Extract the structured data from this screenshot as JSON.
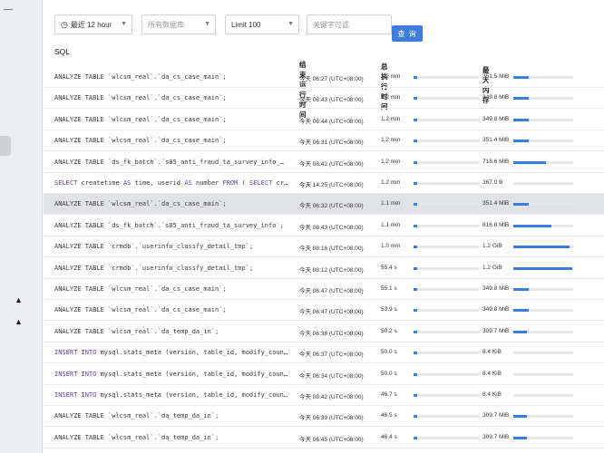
{
  "toolbar": {
    "time_range": "最近 12 hour",
    "database": "所有数据库",
    "limit": "Limit 100",
    "keyword_placeholder": "关键字过滤",
    "search_button": "查 询"
  },
  "columns": {
    "sql": "SQL",
    "end_time": "结束运行时间",
    "total_exec_time": "总执行时间",
    "max_memory": "最大内存"
  },
  "rows": [
    {
      "sql_parts": [
        {
          "t": "ANALYZE TABLE `wlcsm_real`.`da_cs_case_main`;",
          "kw": false
        }
      ],
      "end_time": "今天 06:27 (UTC+08:00)",
      "duration": "1.2 min",
      "duration_fraction": 0.06,
      "memory": "351.5 MiB",
      "memory_fraction": 0.26,
      "highlight": false
    },
    {
      "sql_parts": [
        {
          "t": "ANALYZE TABLE `wlcsm_real`.`da_cs_case_main`;",
          "kw": false
        }
      ],
      "end_time": "今天 06:43 (UTC+08:00)",
      "duration": "1.2 min",
      "duration_fraction": 0.06,
      "memory": "349.8 MiB",
      "memory_fraction": 0.26,
      "highlight": false
    },
    {
      "sql_parts": [
        {
          "t": "ANALYZE TABLE `wlcsm_real`.`da_cs_case_main`;",
          "kw": false
        }
      ],
      "end_time": "今天 06:44 (UTC+08:00)",
      "duration": "1.2 min",
      "duration_fraction": 0.06,
      "memory": "349.8 MiB",
      "memory_fraction": 0.26,
      "highlight": false
    },
    {
      "sql_parts": [
        {
          "t": "ANALYZE TABLE `wlcsm_real`.`da_cs_case_main`;",
          "kw": false
        }
      ],
      "end_time": "今天 06:31 (UTC+08:00)",
      "duration": "1.2 min",
      "duration_fraction": 0.06,
      "memory": "351.4 MiB",
      "memory_fraction": 0.26,
      "highlight": false
    },
    {
      "sql_parts": [
        {
          "t": "ANALYZE TABLE `ds_fk_batch`.`s05_anti_fraud_ta_survey_info_…",
          "kw": false
        }
      ],
      "end_time": "今天 08:42 (UTC+08:00)",
      "duration": "1.2 min",
      "duration_fraction": 0.06,
      "memory": "718.6 MiB",
      "memory_fraction": 0.55,
      "highlight": false
    },
    {
      "sql_parts": [
        {
          "t": "SELECT",
          "kw": true
        },
        {
          "t": " createtime ",
          "kw": false
        },
        {
          "t": "AS",
          "kw": true
        },
        {
          "t": " time, userid ",
          "kw": false
        },
        {
          "t": "AS",
          "kw": true
        },
        {
          "t": " number ",
          "kw": false
        },
        {
          "t": "FROM",
          "kw": true
        },
        {
          "t": " ( ",
          "kw": false
        },
        {
          "t": "SELECT",
          "kw": true
        },
        {
          "t": " cr…",
          "kw": false
        }
      ],
      "end_time": "今天 14:25 (UTC+08:00)",
      "duration": "1.2 min",
      "duration_fraction": 0.06,
      "memory": "367.0 B",
      "memory_fraction": 0.0,
      "highlight": false
    },
    {
      "sql_parts": [
        {
          "t": "ANALYZE TABLE `wlcsm_real`.`da_cs_case_main`;",
          "kw": false
        }
      ],
      "end_time": "今天 06:32 (UTC+08:00)",
      "duration": "1.1 min",
      "duration_fraction": 0.06,
      "memory": "351.4 MiB",
      "memory_fraction": 0.26,
      "highlight": true
    },
    {
      "sql_parts": [
        {
          "t": "ANALYZE TABLE `ds_fk_batch`.`s05_anti_fraud_ta_survey_info`;",
          "kw": false
        }
      ],
      "end_time": "今天 08:43 (UTC+08:00)",
      "duration": "1.1 min",
      "duration_fraction": 0.06,
      "memory": "816.8 MiB",
      "memory_fraction": 0.63,
      "highlight": false
    },
    {
      "sql_parts": [
        {
          "t": "ANALYZE TABLE `crmdb`.`userinfo_classfy_detail_tmp`;",
          "kw": false
        }
      ],
      "end_time": "今天 08:16 (UTC+08:00)",
      "duration": "1.0 min",
      "duration_fraction": 0.05,
      "memory": "1.2 GiB",
      "memory_fraction": 0.94,
      "highlight": false
    },
    {
      "sql_parts": [
        {
          "t": "ANALYZE TABLE `crmdb`.`userinfo_classfy_detail_tmp`;",
          "kw": false
        }
      ],
      "end_time": "今天 08:12 (UTC+08:00)",
      "duration": "55.4 s",
      "duration_fraction": 0.05,
      "memory": "1.2 GiB",
      "memory_fraction": 0.98,
      "highlight": false
    },
    {
      "sql_parts": [
        {
          "t": "ANALYZE TABLE `wlcsm_real`.`da_cs_case_main`;",
          "kw": false
        }
      ],
      "end_time": "今天 06:47 (UTC+08:00)",
      "duration": "55.1 s",
      "duration_fraction": 0.05,
      "memory": "349.8 MiB",
      "memory_fraction": 0.26,
      "highlight": false
    },
    {
      "sql_parts": [
        {
          "t": "ANALYZE TABLE `wlcsm_real`.`da_cs_case_main`;",
          "kw": false
        }
      ],
      "end_time": "今天 06:47 (UTC+08:00)",
      "duration": "53.9 s",
      "duration_fraction": 0.05,
      "memory": "349.8 MiB",
      "memory_fraction": 0.26,
      "highlight": false
    },
    {
      "sql_parts": [
        {
          "t": "ANALYZE TABLE `wlcsm_real`.`da_temp_da_in`;",
          "kw": false
        }
      ],
      "end_time": "今天 06:38 (UTC+08:00)",
      "duration": "50.2 s",
      "duration_fraction": 0.05,
      "memory": "309.7 MiB",
      "memory_fraction": 0.23,
      "highlight": false
    },
    {
      "sql_parts": [
        {
          "t": "INSERT INTO",
          "kw": true
        },
        {
          "t": " mysql.stats_meta (version, table_id, modify_coun…",
          "kw": false
        }
      ],
      "end_time": "今天 06:37 (UTC+08:00)",
      "duration": "50.0 s",
      "duration_fraction": 0.05,
      "memory": "8.4 KiB",
      "memory_fraction": 0.0,
      "highlight": false
    },
    {
      "sql_parts": [
        {
          "t": "INSERT INTO",
          "kw": true
        },
        {
          "t": " mysql.stats_meta (version, table_id, modify_coun…",
          "kw": false
        }
      ],
      "end_time": "今天 06:34 (UTC+08:00)",
      "duration": "50.0 s",
      "duration_fraction": 0.05,
      "memory": "8.4 KiB",
      "memory_fraction": 0.0,
      "highlight": false
    },
    {
      "sql_parts": [
        {
          "t": "INSERT INTO",
          "kw": true
        },
        {
          "t": " mysql.stats_meta (version, table_id, modify_coun…",
          "kw": false
        }
      ],
      "end_time": "今天 08:42 (UTC+08:00)",
      "duration": "46.7 s",
      "duration_fraction": 0.05,
      "memory": "8.4 KiB",
      "memory_fraction": 0.0,
      "highlight": false
    },
    {
      "sql_parts": [
        {
          "t": "ANALYZE TABLE `wlcsm_real`.`da_temp_da_in`;",
          "kw": false
        }
      ],
      "end_time": "今天 06:39 (UTC+08:00)",
      "duration": "46.5 s",
      "duration_fraction": 0.05,
      "memory": "309.7 MiB",
      "memory_fraction": 0.23,
      "highlight": false
    },
    {
      "sql_parts": [
        {
          "t": "ANALYZE TABLE `wlcsm_real`.`da_temp_da_in`;",
          "kw": false
        }
      ],
      "end_time": "今天 06:45 (UTC+08:00)",
      "duration": "46.4 s",
      "duration_fraction": 0.05,
      "memory": "309.7 MiB",
      "memory_fraction": 0.23,
      "highlight": false
    }
  ],
  "icons": {
    "clock": "clock-icon",
    "info": "info-icon",
    "sort_desc": "arrow-down-icon",
    "dropdown": "chevron-down-icon",
    "collapse": "chevron-up-icon"
  },
  "colors": {
    "accent": "#3d7ddb",
    "keyword": "#6b3fa0",
    "highlight_row": "#e2e3e6"
  }
}
